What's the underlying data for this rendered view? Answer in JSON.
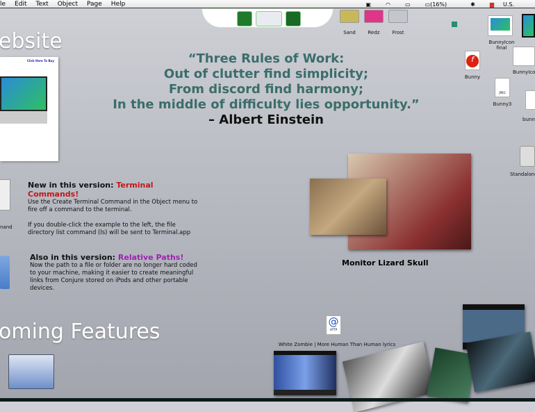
{
  "menu": [
    "le",
    "Edit",
    "Text",
    "Object",
    "Page",
    "Help"
  ],
  "status": {
    "battery": "(16%)",
    "locale": "U.S."
  },
  "swatches": [
    {
      "label": "Sand",
      "color": "#c9b85a"
    },
    {
      "label": "Redz",
      "color": "#e0358a"
    },
    {
      "label": "Frost",
      "color": "#c4c6ce"
    }
  ],
  "headings": {
    "website": "ebsite",
    "coming": "oming Features"
  },
  "buy": "Click Here To Buy",
  "quote": {
    "l1": "“Three Rules of Work:",
    "l2": "Out of clutter find simplicity;",
    "l3": "From discord find harmony;",
    "l4": "In the middle of difficulty lies opportunity.”",
    "author": "– Albert Einstein"
  },
  "terminal": {
    "title": "New in this version: ",
    "highlight": "Terminal Commands!",
    "p1": "Use the Create Terminal Command in the Object menu to fire off a command to the terminal.",
    "p2": "If you double-click the example to the left, the file directory list command (ls) will be sent to Terminal.app",
    "icon_label": "nand"
  },
  "paths": {
    "title": "Also in this version: ",
    "highlight": "Relative Paths!",
    "p1": "Now the path to a file or folder are no longer hard coded to your machine, making it easier to create meaningful links from Conjure stored on iPods and other portable devices."
  },
  "photo_caption": "Monitor Lizard Skull",
  "desktop_icons": {
    "bunnyicon_final": "BunnyIcon final",
    "bunnyicon": "BunnyIcon",
    "bunny": "Bunny",
    "bunny3": "Bunny3",
    "bunny_png": "bunny",
    "standalone": "Standalone",
    "jpeg": "JPEG",
    "http": "HTTP",
    "weblink": "White Zombie | More Human Than Human lyrics"
  },
  "colors": {
    "terminal": "#c01818",
    "paths": "#a020b0",
    "quote": "#3b6d6b"
  }
}
